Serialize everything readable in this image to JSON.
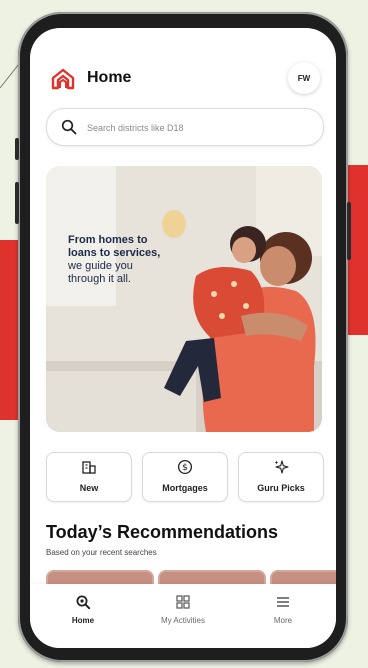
{
  "header": {
    "title": "Home",
    "avatar_initials": "FW"
  },
  "search": {
    "placeholder": "Search districts like D18"
  },
  "hero": {
    "line1": "From homes to",
    "line2": "loans to services,",
    "line3": "we guide you",
    "line4": "through it all."
  },
  "quick_actions": [
    {
      "label": "New",
      "icon": "building-icon"
    },
    {
      "label": "Mortgages",
      "icon": "dollar-circle-icon"
    },
    {
      "label": "Guru Picks",
      "icon": "sparkle-icon"
    }
  ],
  "recommendations": {
    "title": "Today’s Recommendations",
    "subtitle": "Based on your recent searches"
  },
  "bottom_nav": [
    {
      "label": "Home",
      "icon": "search-home-icon",
      "active": true
    },
    {
      "label": "My Activities",
      "icon": "grid-icon",
      "active": false
    },
    {
      "label": "More",
      "icon": "menu-icon",
      "active": false
    }
  ],
  "colors": {
    "brand_red": "#e0322d",
    "text_dark": "#111111",
    "hero_text": "#1b2a4a"
  }
}
